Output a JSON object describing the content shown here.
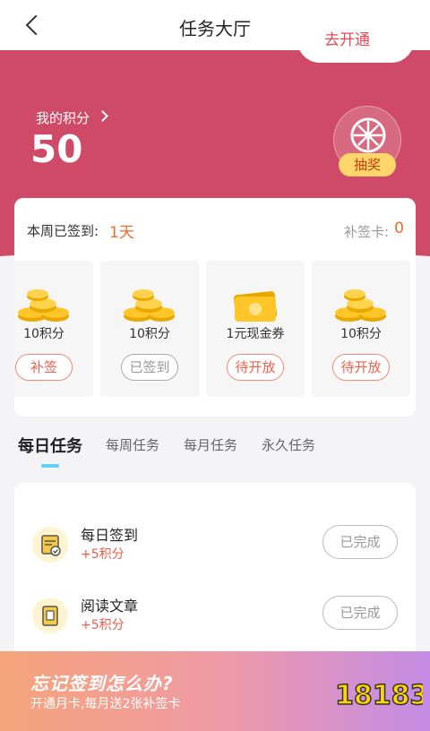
{
  "header": {
    "title": "任务大厅"
  },
  "banner": {
    "points_label": "我的积分",
    "points_value": "50",
    "lottery_label": "抽奖"
  },
  "signin": {
    "week_label": "本周已签到:",
    "week_value": "1天",
    "card_label": "补签卡:",
    "card_value": "0",
    "days": [
      {
        "reward": "10积分",
        "button": "补签",
        "icon": "coins-icon"
      },
      {
        "reward": "10积分",
        "button": "已签到",
        "icon": "coins-icon"
      },
      {
        "reward": "1元现金券",
        "button": "待开放",
        "icon": "cash-voucher-icon"
      },
      {
        "reward": "10积分",
        "button": "待开放",
        "icon": "coins-icon"
      }
    ]
  },
  "tabs": [
    "每日任务",
    "每周任务",
    "每月任务",
    "永久任务"
  ],
  "tasks": [
    {
      "name": "每日签到",
      "reward": "+5积分",
      "button": "已完成",
      "icon": "calendar-check-icon"
    },
    {
      "name": "阅读文章",
      "reward": "+5积分",
      "button": "已完成",
      "icon": "article-icon"
    }
  ],
  "promo": {
    "title": "忘记签到怎么办?",
    "subtitle": "开通月卡,每月送2张补签卡",
    "button": "去开通"
  },
  "watermark": "18183",
  "colors": {
    "banner": "#cf4a66",
    "accent": "#f06a2c",
    "tab_underline": "#62d1f0"
  }
}
